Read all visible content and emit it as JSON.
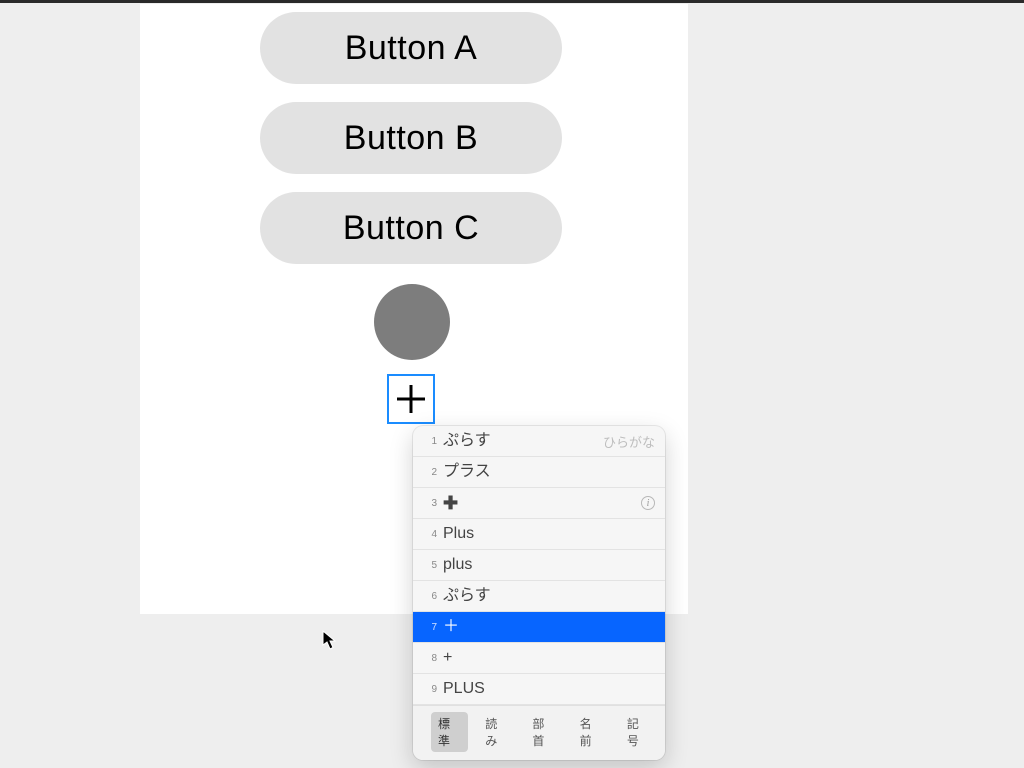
{
  "buttons": {
    "a": "Button A",
    "b": "Button B",
    "c": "Button C"
  },
  "input": {
    "glyph": "＋"
  },
  "ime": {
    "hint": "ひらがな",
    "items": [
      {
        "idx": "1",
        "label": "ぷらす"
      },
      {
        "idx": "2",
        "label": "プラス"
      },
      {
        "idx": "3",
        "label": "✚",
        "info": true
      },
      {
        "idx": "4",
        "label": "Plus"
      },
      {
        "idx": "5",
        "label": "plus"
      },
      {
        "idx": "6",
        "label": "ぷらす"
      },
      {
        "idx": "7",
        "label": "＋",
        "selected": true
      },
      {
        "idx": "8",
        "label": "+"
      },
      {
        "idx": "9",
        "label": "PLUS"
      }
    ],
    "tabs": {
      "standard": "標準",
      "reading": "読み",
      "radical": "部首",
      "name": "名前",
      "symbol": "記号"
    }
  }
}
